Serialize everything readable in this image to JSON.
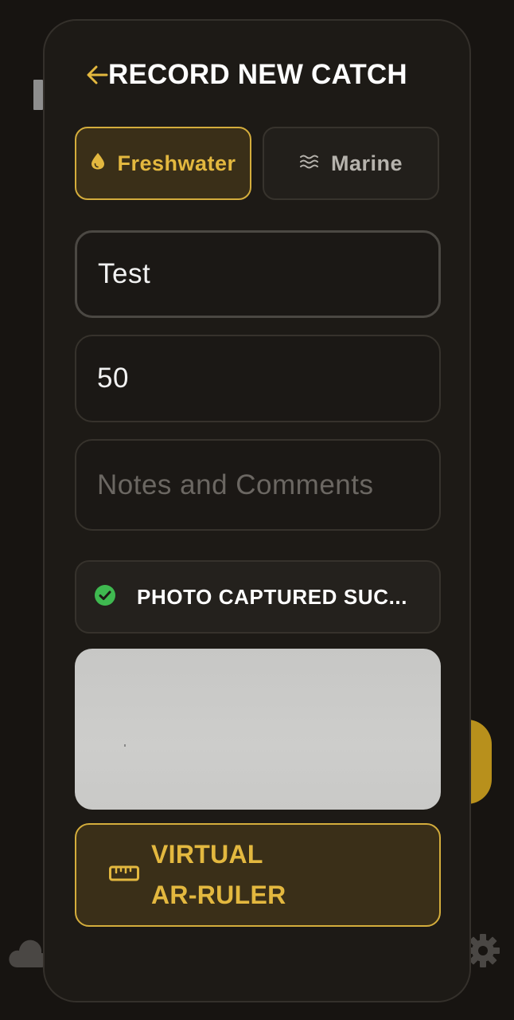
{
  "header": {
    "title": "RECORD NEW CATCH",
    "back_icon": "arrow-left-icon"
  },
  "water_type": {
    "selected": "Freshwater",
    "options": [
      {
        "label": "Freshwater",
        "icon": "water-drop-icon"
      },
      {
        "label": "Marine",
        "icon": "waves-icon"
      }
    ]
  },
  "form": {
    "species_value": "Test",
    "length_value": "50",
    "notes_value": "",
    "notes_placeholder": "Notes and Comments"
  },
  "photo_status": {
    "icon": "check-circle-icon",
    "text": "PHOTO CAPTURED SUC..."
  },
  "ar_ruler": {
    "icon": "ruler-icon",
    "line1": "VIRTUAL",
    "line2": "AR-RULER"
  },
  "background": {
    "icons": [
      "cloud-icon",
      "gear-icon"
    ]
  },
  "colors": {
    "accent": "#e3b83f",
    "accent_bg": "#3a2f18",
    "modal_bg": "#1d1a16",
    "success": "#3fb950"
  }
}
